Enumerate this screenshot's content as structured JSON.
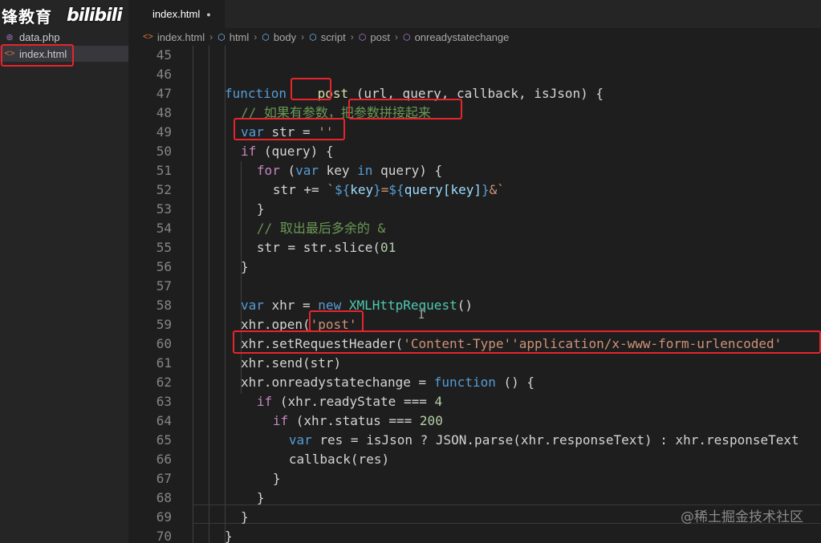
{
  "watermark_brand": "锋教育",
  "bilibili_logo": "bilibili",
  "explorer": {
    "files": [
      {
        "name": "data.php",
        "icon": "php-file-icon"
      },
      {
        "name": "index.html",
        "icon": "html-file-icon",
        "selected": true
      }
    ]
  },
  "tab": {
    "label": "index.html",
    "modified_dot": "●"
  },
  "breadcrumb": [
    "index.html",
    "html",
    "body",
    "script",
    "post",
    "onreadystatechange"
  ],
  "editor": {
    "lines": [
      {
        "n": "45",
        "tokens": []
      },
      {
        "n": "46",
        "tokens": []
      },
      {
        "n": "47",
        "tokens": [
          [
            "kw",
            "function"
          ],
          [
            "",
            "    "
          ],
          [
            "fn",
            "post"
          ],
          [
            "",
            " (url, query, callback, isJson) {"
          ]
        ],
        "indent": 6
      },
      {
        "n": "48",
        "tokens": [
          [
            "cm",
            "// 如果有参数，把参数拼接起来"
          ]
        ],
        "indent": 8
      },
      {
        "n": "49",
        "tokens": [
          [
            "kw",
            "var"
          ],
          [
            "",
            " str = "
          ],
          [
            "str",
            "''"
          ]
        ],
        "indent": 8
      },
      {
        "n": "50",
        "tokens": [
          [
            "ctl",
            "if"
          ],
          [
            "",
            " (query) {"
          ]
        ],
        "indent": 8
      },
      {
        "n": "51",
        "tokens": [
          [
            "ctl",
            "for"
          ],
          [
            "",
            " ("
          ],
          [
            "kw",
            "var"
          ],
          [
            "",
            " key "
          ],
          [
            "kw",
            "in"
          ],
          [
            "",
            " query) {"
          ]
        ],
        "indent": 10
      },
      {
        "n": "52",
        "tokens": [
          [
            "",
            "str += "
          ],
          [
            "str",
            "`"
          ],
          [
            "tpl",
            "${"
          ],
          [
            "vr",
            "key"
          ],
          [
            "tpl",
            "}"
          ],
          [
            "str",
            "="
          ],
          [
            "tpl",
            "${"
          ],
          [
            "vr",
            "query[key]"
          ],
          [
            "tpl",
            "}"
          ],
          [
            "str",
            "&`"
          ]
        ],
        "indent": 12
      },
      {
        "n": "53",
        "tokens": [
          [
            "",
            "}"
          ]
        ],
        "indent": 10
      },
      {
        "n": "54",
        "tokens": [
          [
            "cm",
            "// 取出最后多余的 &"
          ]
        ],
        "indent": 10
      },
      {
        "n": "55",
        "tokens": [
          [
            "",
            "str = str.slice("
          ],
          [
            "num",
            "0"
          ],
          [
            ", -"
          ],
          [
            "num",
            "1"
          ],
          [
            ")"
          ]
        ],
        "indent": 10
      },
      {
        "n": "56",
        "tokens": [
          [
            "",
            "}"
          ]
        ],
        "indent": 8
      },
      {
        "n": "57",
        "tokens": []
      },
      {
        "n": "58",
        "tokens": [
          [
            "kw",
            "var"
          ],
          [
            "",
            " xhr = "
          ],
          [
            "kw",
            "new"
          ],
          [
            "",
            " "
          ],
          [
            "cls",
            "XMLHttpRequest"
          ],
          [
            "",
            "()"
          ]
        ],
        "indent": 8
      },
      {
        "n": "59",
        "tokens": [
          [
            "",
            "xhr.open("
          ],
          [
            "str",
            "'post'"
          ],
          [
            ",  url)"
          ]
        ],
        "indent": 8
      },
      {
        "n": "60",
        "tokens": [
          [
            "",
            "xhr.setRequestHeader("
          ],
          [
            "str",
            "'Content-Type'"
          ],
          [
            ", "
          ],
          [
            "str",
            "'application/x-www-form-urlencoded'"
          ],
          [
            ")"
          ]
        ],
        "indent": 8
      },
      {
        "n": "61",
        "tokens": [
          [
            "",
            "xhr.send(str)"
          ]
        ],
        "indent": 8
      },
      {
        "n": "62",
        "tokens": [
          [
            "",
            "xhr.onreadystatechange = "
          ],
          [
            "kw",
            "function"
          ],
          [
            "",
            " () {"
          ]
        ],
        "indent": 8
      },
      {
        "n": "63",
        "tokens": [
          [
            "ctl",
            "if"
          ],
          [
            "",
            " (xhr.readyState === "
          ],
          [
            "num",
            "4"
          ],
          [
            ") {"
          ]
        ],
        "indent": 10
      },
      {
        "n": "64",
        "tokens": [
          [
            "ctl",
            "if"
          ],
          [
            "",
            " (xhr.status === "
          ],
          [
            "num",
            "200"
          ],
          [
            ") {"
          ]
        ],
        "indent": 12
      },
      {
        "n": "65",
        "tokens": [
          [
            "kw",
            "var"
          ],
          [
            "",
            " res = isJson ? JSON.parse(xhr.responseText) : xhr.responseText"
          ]
        ],
        "indent": 14
      },
      {
        "n": "66",
        "tokens": [
          [
            "",
            "callback(res)"
          ]
        ],
        "indent": 14
      },
      {
        "n": "67",
        "tokens": [
          [
            "",
            "}"
          ]
        ],
        "indent": 12
      },
      {
        "n": "68",
        "tokens": [
          [
            "",
            "}"
          ]
        ],
        "indent": 10
      },
      {
        "n": "69",
        "tokens": [
          [
            "",
            "}"
          ]
        ],
        "indent": 8
      },
      {
        "n": "70",
        "tokens": [
          [
            "",
            "}"
          ]
        ],
        "indent": 6
      }
    ]
  },
  "bottom_watermark": "@稀土掘金技术社区",
  "highlight_color": "#e8242c"
}
